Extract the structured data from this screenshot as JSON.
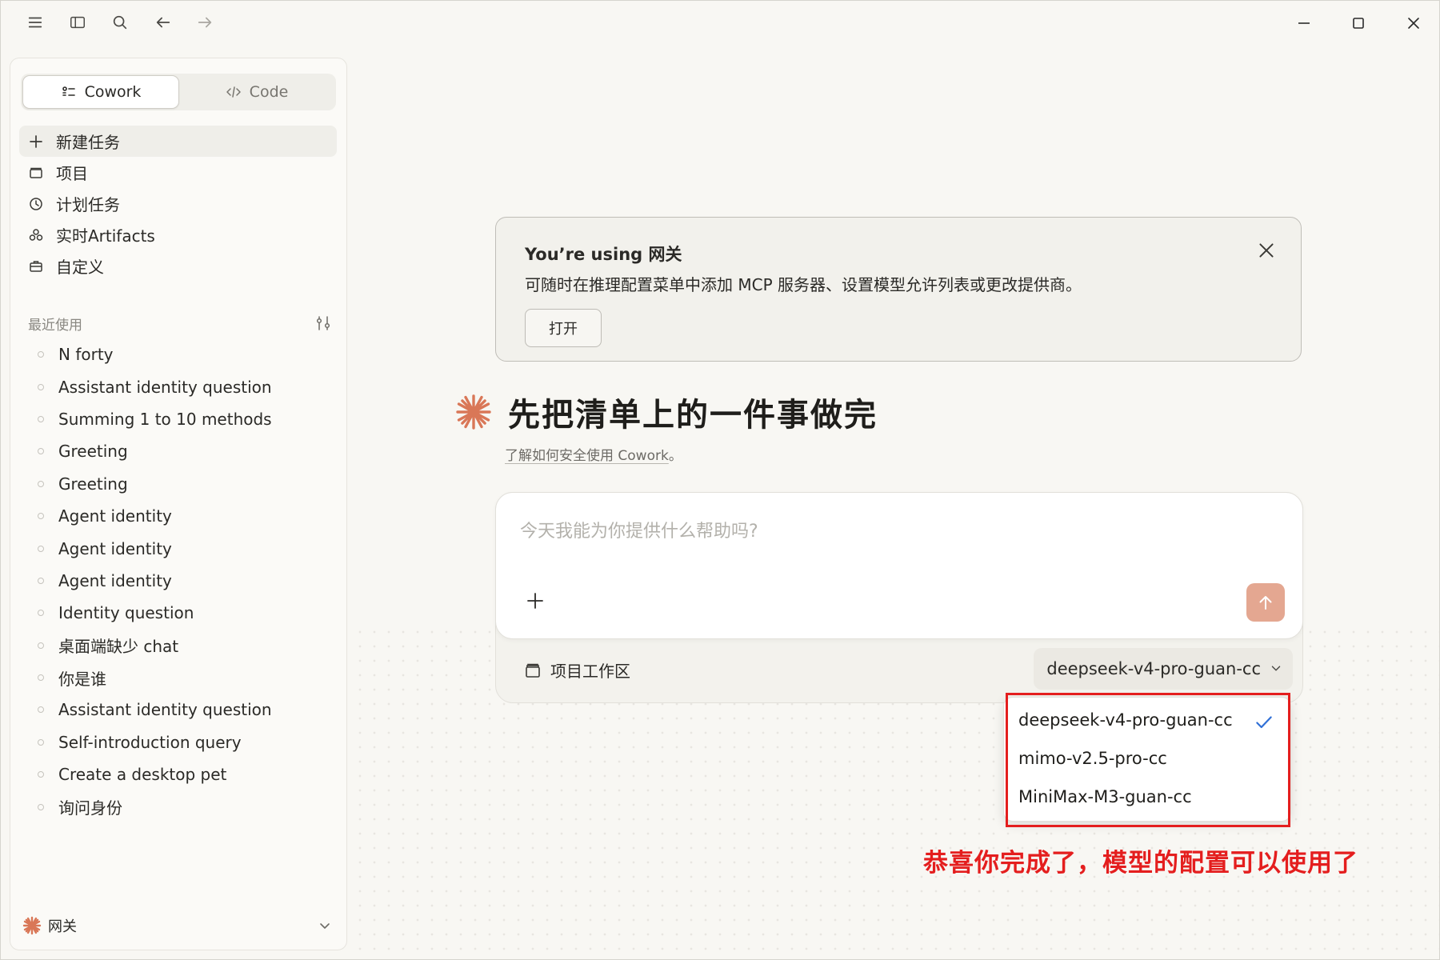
{
  "sidebar": {
    "tabs": [
      {
        "label": "Cowork",
        "active": true
      },
      {
        "label": "Code",
        "active": false
      }
    ],
    "nav": [
      {
        "label": "新建任务",
        "icon": "plus-icon",
        "active": true
      },
      {
        "label": "项目",
        "icon": "folder-icon"
      },
      {
        "label": "计划任务",
        "icon": "clock-icon"
      },
      {
        "label": "实时Artifacts",
        "icon": "artifacts-icon"
      },
      {
        "label": "自定义",
        "icon": "briefcase-icon"
      }
    ],
    "recent_title": "最近使用",
    "recent": [
      "N forty",
      "Assistant identity question",
      "Summing 1 to 10 methods",
      "Greeting",
      "Greeting",
      "Agent identity",
      "Agent identity",
      "Agent identity",
      "Identity question",
      "桌面端缺少 chat",
      "你是谁",
      "Assistant identity question",
      "Self-introduction query",
      "Create a desktop pet",
      "询问身份"
    ],
    "footer_label": "网关"
  },
  "banner": {
    "title": "You’re using 网关",
    "text": "可随时在推理配置菜单中添加 MCP 服务器、设置模型允许列表或更改提供商。",
    "button": "打开"
  },
  "hero": {
    "title": "先把清单上的一件事做完",
    "sub_link": "了解如何安全使用 Cowork",
    "sub_suffix": "。"
  },
  "composer": {
    "placeholder": "今天我能为你提供什么帮助吗?",
    "workspace": "项目工作区",
    "model": "deepseek-v4-pro-guan-cc"
  },
  "dropdown": {
    "options": [
      {
        "label": "deepseek-v4-pro-guan-cc",
        "selected": true
      },
      {
        "label": "mimo-v2.5-pro-cc",
        "selected": false
      },
      {
        "label": "MiniMax-M3-guan-cc",
        "selected": false
      }
    ]
  },
  "annotation": "恭喜你完成了，模型的配置可以使用了",
  "colors": {
    "accent": "#d97757",
    "send_button": "#e4a791",
    "annotation_red": "#e41e1e",
    "check_blue": "#2f6fd6"
  }
}
